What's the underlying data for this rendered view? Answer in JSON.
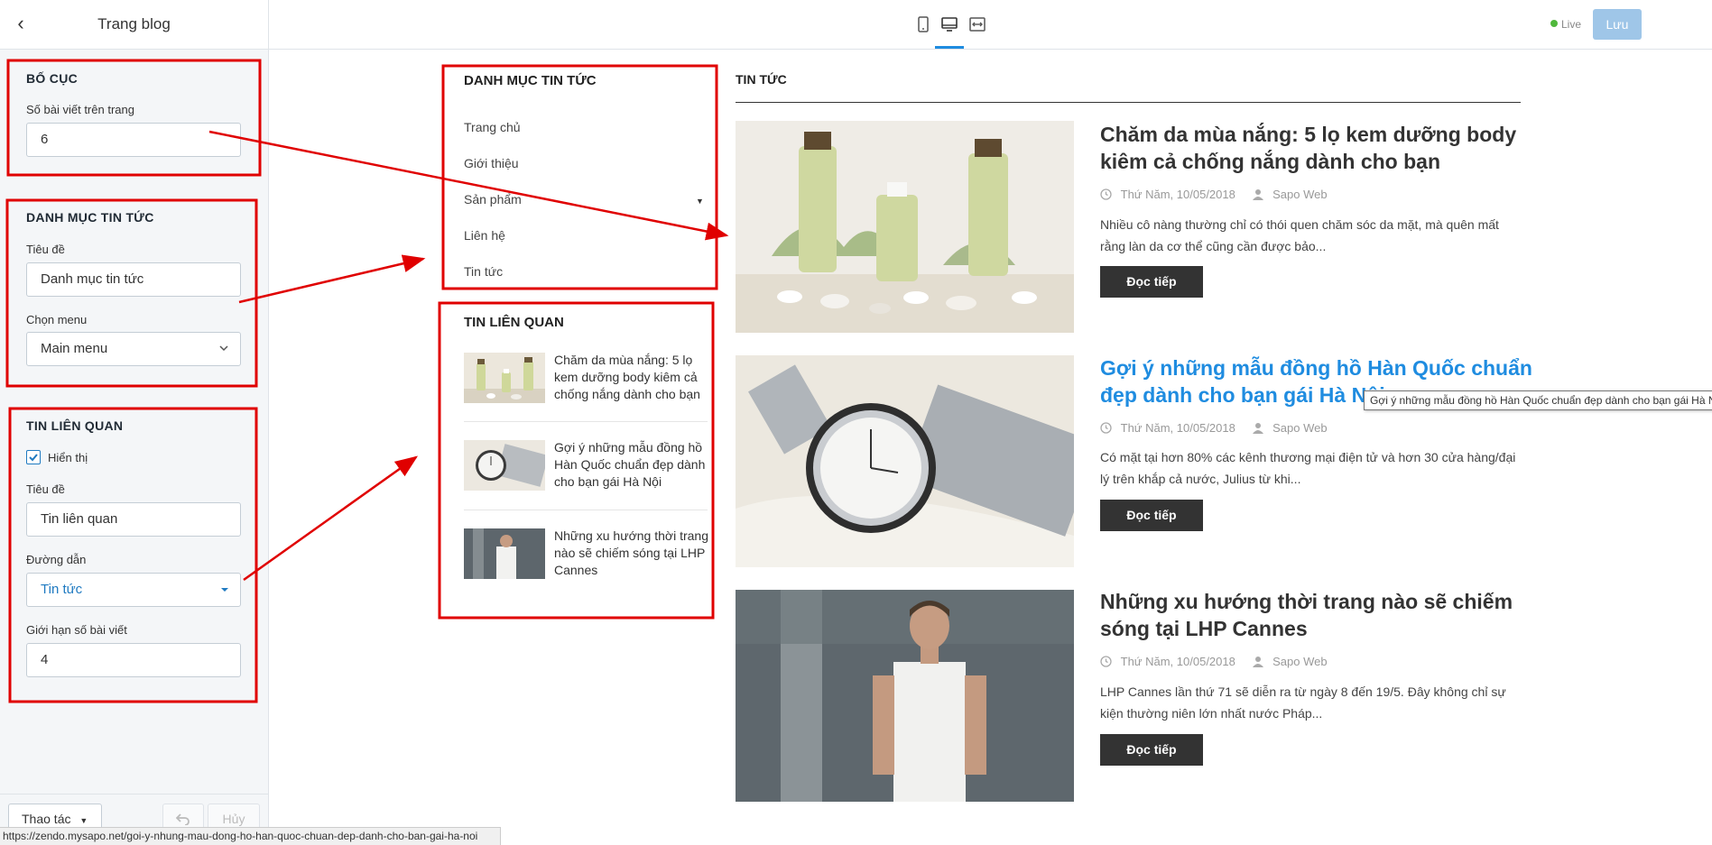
{
  "sidebar": {
    "title": "Trang blog",
    "layout": {
      "heading": "BỐ CỤC",
      "posts_per_page_label": "Số bài viết trên trang",
      "posts_per_page_value": "6"
    },
    "categories": {
      "heading": "DANH MỤC TIN TỨC",
      "title_label": "Tiêu đề",
      "title_value": "Danh mục tin tức",
      "menu_label": "Chọn menu",
      "menu_value": "Main menu"
    },
    "related": {
      "heading": "TIN LIÊN QUAN",
      "show_label": "Hiển thị",
      "show_checked": true,
      "title_label": "Tiêu đề",
      "title_value": "Tin liên quan",
      "link_label": "Đường dẫn",
      "link_value": "Tin tức",
      "limit_label": "Giới hạn số bài viết",
      "limit_value": "4"
    },
    "footer": {
      "actions_label": "Thao tác",
      "cancel_label": "Hủy"
    }
  },
  "topbar": {
    "devices": [
      "mobile-icon",
      "desktop-icon",
      "fullwidth-icon"
    ],
    "active_device": "desktop",
    "live_label": "Live",
    "save_label": "Lưu"
  },
  "preview": {
    "categories": {
      "heading": "DANH MỤC TIN TỨC",
      "links": [
        "Trang chủ",
        "Giới thiệu",
        "Sản phẩm",
        "Liên hệ",
        "Tin tức"
      ]
    },
    "related": {
      "heading": "TIN LIÊN QUAN",
      "items": [
        "Chăm da mùa nắng: 5 lọ kem dưỡng body kiêm cả chống nắng dành cho bạn",
        "Gợi ý những mẫu đồng hồ Hàn Quốc chuẩn đẹp dành cho bạn gái Hà Nội",
        "Những xu hướng thời trang nào sẽ chiếm sóng tại LHP Cannes"
      ]
    },
    "news_heading": "TIN TỨC",
    "posts": [
      {
        "title": "Chăm da mùa nắng: 5 lọ kem dưỡng body kiêm cả chống nắng dành cho bạn",
        "date": "Thứ Năm, 10/05/2018",
        "author": "Sapo Web",
        "excerpt": "Nhiều cô nàng thường chỉ có thói quen chăm sóc da mặt, mà quên mất rằng làn da cơ thể cũng cần được bảo...",
        "read_more": "Đọc tiếp"
      },
      {
        "title": "Gợi ý những mẫu đồng hồ Hàn Quốc chuẩn đẹp dành cho bạn gái Hà Nội",
        "date": "Thứ Năm, 10/05/2018",
        "author": "Sapo Web",
        "excerpt": "Có mặt tại hơn 80% các kênh thương mại điện tử và hơn 30 cửa hàng/đại lý trên khắp cả nước, Julius từ khi...",
        "read_more": "Đọc tiếp"
      },
      {
        "title": "Những xu hướng thời trang nào sẽ chiếm sóng tại LHP Cannes",
        "date": "Thứ Năm, 10/05/2018",
        "author": "Sapo Web",
        "excerpt": "LHP Cannes lần thứ 71 sẽ diễn ra từ ngày 8 đến 19/5. Đây không chỉ sự kiện thường niên lớn nhất nước Pháp...",
        "read_more": "Đọc tiếp"
      }
    ],
    "tooltip": "Gợi ý những mẫu đồng hồ Hàn Quốc chuẩn đẹp dành cho bạn gái Hà Nội"
  },
  "status_bar": {
    "url": "https://zendo.mysapo.net/goi-y-nhung-mau-dong-ho-han-quoc-chuan-dep-danh-cho-ban-gai-ha-noi"
  },
  "colors": {
    "accent": "#1f8ce0",
    "annotation": "#e00000",
    "button_dark": "#333333"
  }
}
